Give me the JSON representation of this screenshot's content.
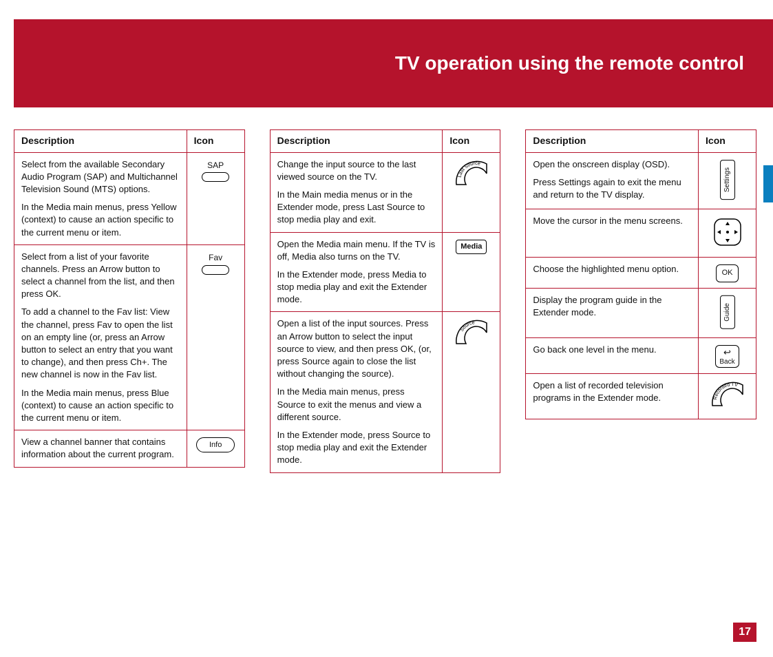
{
  "header": {
    "title": "TV operation using the remote control"
  },
  "page_number": "17",
  "col_headers": {
    "description": "Description",
    "icon": "Icon"
  },
  "col1": [
    {
      "desc": [
        "Select from the available Secondary Audio Program (SAP) and Multichannel Television Sound (MTS) options.",
        "In the Media main menus, press Yellow (context) to cause an action specific to the current menu or item."
      ],
      "icon_label": "SAP",
      "icon_type": "label-pill"
    },
    {
      "desc": [
        "Select from a list of your favorite channels. Press an Arrow button to select a channel from the list, and then press OK.",
        "To add a channel to the Fav list: View the channel, press Fav to open the list on an empty line (or, press an Arrow button to select an entry that you want to change), and then press Ch+. The new channel is now in the Fav list.",
        "In the Media main menus, press Blue (context) to cause an action specific to the current menu or item."
      ],
      "icon_label": "Fav",
      "icon_type": "label-pill"
    },
    {
      "desc": [
        "View a channel banner that contains information about the current program."
      ],
      "icon_label": "Info",
      "icon_type": "pill-info"
    }
  ],
  "col2": [
    {
      "desc": [
        "Change the input source to the last viewed source on the TV.",
        "In the Main media menus or in the Extender mode, press Last Source to stop media play and exit."
      ],
      "icon_label": "Last Source",
      "icon_type": "arc"
    },
    {
      "desc": [
        "Open the Media main menu. If the TV is off, Media also turns on the TV.",
        "In the Extender mode, press Media to stop media play and exit the Extender mode."
      ],
      "icon_label": "Media",
      "icon_type": "rect"
    },
    {
      "desc": [
        "Open a list of the input sources. Press an Arrow button to select the input source to view, and then press OK, (or, press Source again to close the list without changing the source).",
        "In the Media main menus, press Source to exit the menus and view a different source.",
        "In the Extender mode, press Source to stop media play and exit the Extender mode."
      ],
      "icon_label": "Source",
      "icon_type": "arc"
    }
  ],
  "col3": [
    {
      "desc": [
        "Open the onscreen display (OSD).",
        "Press Settings again to exit the menu and return to the TV display."
      ],
      "icon_label": "Settings",
      "icon_type": "vert"
    },
    {
      "desc": [
        "Move the cursor in the menu screens."
      ],
      "icon_label": "",
      "icon_type": "dpad"
    },
    {
      "desc": [
        "Choose the highlighted menu option."
      ],
      "icon_label": "OK",
      "icon_type": "ok"
    },
    {
      "desc": [
        "Display the program guide in the Extender mode."
      ],
      "icon_label": "Guide",
      "icon_type": "vert"
    },
    {
      "desc": [
        "Go back one level in the menu."
      ],
      "icon_label": "Back",
      "icon_type": "back"
    },
    {
      "desc": [
        "Open a list of recorded television programs in the Extender mode."
      ],
      "icon_label": "Recorded TV",
      "icon_type": "arc"
    }
  ]
}
